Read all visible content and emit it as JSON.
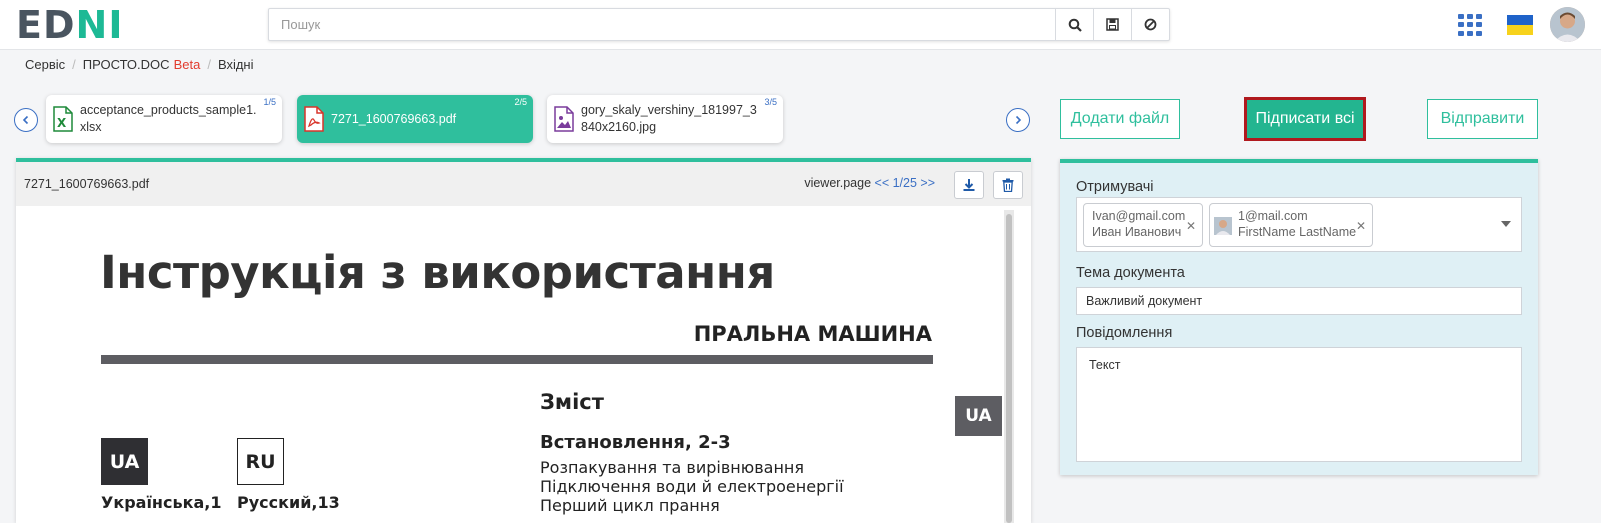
{
  "header": {
    "logo_ed": "ED",
    "logo_n": "N",
    "logo_i": "I",
    "search_placeholder": "Пошук"
  },
  "breadcrumb": {
    "items": [
      "Сервіс",
      "ПРОСТО.DOC",
      "Вхідні"
    ],
    "beta": "Beta"
  },
  "files": [
    {
      "name": "acceptance_products_sample1.xlsx",
      "counter": "1/5",
      "type": "xlsx-icon",
      "active": false
    },
    {
      "name": "7271_1600769663.pdf",
      "counter": "2/5",
      "type": "pdf-icon",
      "active": true
    },
    {
      "name": "gory_skaly_vershiny_181997_3840x2160.jpg",
      "counter": "3/5",
      "type": "image-icon",
      "active": false
    }
  ],
  "actions": {
    "add_file": "Додати файл",
    "sign_all": "Підписати всі",
    "send": "Відправити"
  },
  "viewer": {
    "filename": "7271_1600769663.pdf",
    "pager_label": "viewer.page",
    "pager_value": "<< 1/25 >>"
  },
  "document": {
    "title": "Інструкція з використання",
    "subtitle": "ПРАЛЬНА МАШИНА",
    "side_tag": "UA",
    "lang_ua": "UA",
    "lang_ru": "RU",
    "lang_ua_label": "Українська,1",
    "lang_ru_label": "Русский,13",
    "toc_title": "Зміст",
    "toc_section": "Встановлення, 2-3",
    "toc_items": [
      "Розпакування та вирівнювання",
      "Підключення води й електроенергії",
      "Перший цикл прання"
    ]
  },
  "panel": {
    "recipients_label": "Отримувачі",
    "recipients": [
      {
        "email": "Ivan@gmail.com",
        "name": "Иван Иванович"
      },
      {
        "email": "1@mail.com",
        "name": "FirstName LastName"
      }
    ],
    "subject_label": "Тема документа",
    "subject_value": "Важливий документ",
    "message_label": "Повідомлення",
    "message_value": "Текст"
  },
  "colors": {
    "accent": "#2fbf9d",
    "link": "#3a6fc4",
    "highlight_border": "#b0191e"
  }
}
